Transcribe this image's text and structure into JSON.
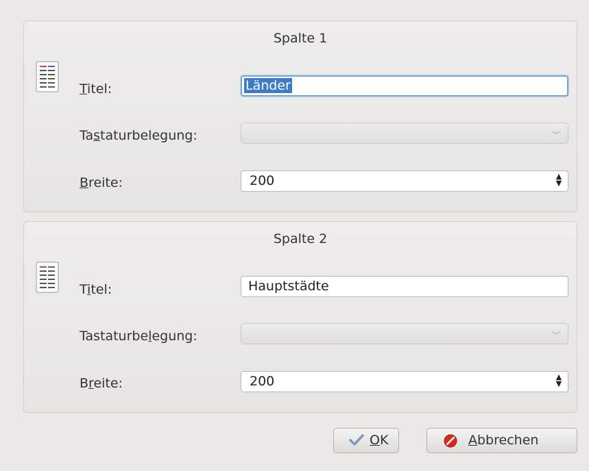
{
  "columns": [
    {
      "title": "Spalte 1",
      "title_label_a": "T",
      "title_label_b": "itel:",
      "title_value": "Länder",
      "keyboard_label_a": "Ta",
      "keyboard_label_b": "s",
      "keyboard_label_c": "taturbelegung:",
      "keyboard_value": "",
      "width_label_a": "B",
      "width_label_b": "reite:",
      "width_value": "200"
    },
    {
      "title": "Spalte 2",
      "title_label_a": "T",
      "title_label_b": "i",
      "title_label_c": "tel:",
      "title_value": "Hauptstädte",
      "keyboard_label_a": "Tastaturbe",
      "keyboard_label_b": "l",
      "keyboard_label_c": "egung:",
      "keyboard_value": "",
      "width_label_a": "B",
      "width_label_b": "r",
      "width_label_c": "eite:",
      "width_value": "200"
    }
  ],
  "buttons": {
    "ok_mnemonic": "O",
    "ok_rest": "K",
    "cancel_mnemonic": "A",
    "cancel_rest": "bbrechen"
  },
  "icons": {
    "column": "document-list-icon",
    "ok": "checkmark-icon",
    "cancel": "cancel-icon"
  },
  "colors": {
    "focus": "#6fa6d6",
    "selection": "#3d7cc8",
    "cancel_red": "#d62a1e",
    "check_blue": "#4a6fa5"
  }
}
